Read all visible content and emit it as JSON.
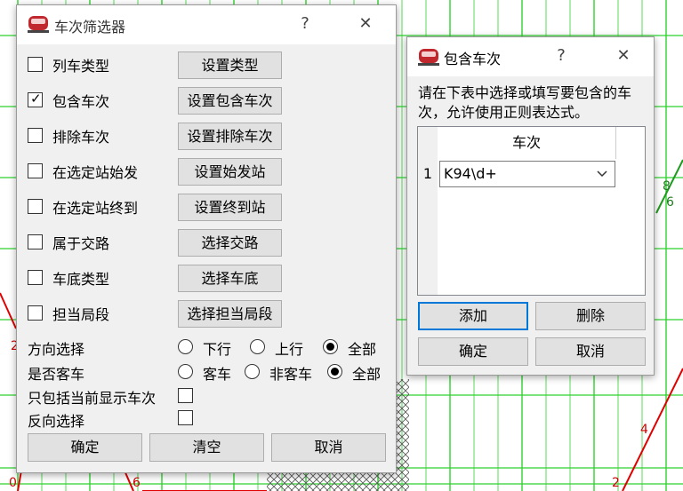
{
  "filter_dialog": {
    "title": "车次筛选器",
    "help": "?",
    "close": "✕",
    "rows": [
      {
        "label": "列车类型",
        "checked": false,
        "button": "设置类型"
      },
      {
        "label": "包含车次",
        "checked": true,
        "button": "设置包含车次"
      },
      {
        "label": "排除车次",
        "checked": false,
        "button": "设置排除车次"
      },
      {
        "label": "在选定站始发",
        "checked": false,
        "button": "设置始发站"
      },
      {
        "label": "在选定站终到",
        "checked": false,
        "button": "设置终到站"
      },
      {
        "label": "属于交路",
        "checked": false,
        "button": "选择交路"
      },
      {
        "label": "车底类型",
        "checked": false,
        "button": "选择车底"
      },
      {
        "label": "担当局段",
        "checked": false,
        "button": "选择担当局段"
      }
    ],
    "direction": {
      "label": "方向选择",
      "options": [
        "下行",
        "上行",
        "全部"
      ],
      "selected": "全部"
    },
    "passenger": {
      "label": "是否客车",
      "options": [
        "客车",
        "非客车",
        "全部"
      ],
      "selected": "全部"
    },
    "only_shown": {
      "label": "只包括当前显示车次",
      "checked": false
    },
    "reverse": {
      "label": "反向选择",
      "checked": false
    },
    "ok": "确定",
    "clear": "清空",
    "cancel": "取消"
  },
  "include_dialog": {
    "title": "包含车次",
    "help": "?",
    "close": "✕",
    "instruction": "请在下表中选择或填写要包含的车次，允许使用正则表达式。",
    "column_header": "车次",
    "rows": [
      {
        "index": "1",
        "value": "K94\\d+"
      }
    ],
    "add": "添加",
    "delete": "删除",
    "ok": "确定",
    "cancel": "取消"
  },
  "background_labels": [
    "0",
    "6",
    "2",
    "8",
    "6",
    "8",
    "4",
    "2"
  ],
  "colors": {
    "grid": "#2fd22f",
    "line": "#e00000",
    "focus": "#0078d7"
  }
}
